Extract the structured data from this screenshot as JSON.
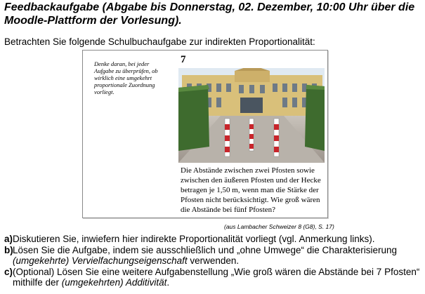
{
  "title": "Feedbackaufgabe (Abgabe bis Donnerstag, 02. Dezember, 10:00 Uhr über die Moodle-Plattform der Vorlesung).",
  "intro": "Betrachten Sie folgende Schulbuchaufgabe zur indirekten Proportionalität:",
  "figure": {
    "note": "Denke daran, bei jeder Aufgabe zu überprüfen, ob wirklich eine umgekehrt proportionale Zuordnung vorliegt.",
    "task_number": "7",
    "task_text": "Die Abstände zwischen zwei Pfosten sowie zwischen den äußeren Pfosten und der Hecke betragen je 1,50 m, wenn man die Stärke der Pfosten nicht berücksichtigt. Wie groß wären die Abstände bei fünf Pfosten?",
    "source": "(aus Lambacher Schweizer 8 (G8), S. 17)"
  },
  "items": {
    "a": {
      "label": "a)",
      "text": "Diskutieren Sie, inwiefern hier indirekte Proportionalität vorliegt (vgl. Anmerkung links)."
    },
    "b": {
      "label": "b)",
      "text1": "Lösen Sie die Aufgabe, indem sie ausschließlich und „ohne Umwege“ die Charakterisierung",
      "em": "(umgekehrte) Vervielfachungseigenschaft",
      "text2": " verwenden."
    },
    "c": {
      "label": "c)",
      "text1": "(Optional) Lösen Sie eine weitere Aufgabenstellung „Wie groß wären die Abstände bei 7 Pfosten“ mithilfe der ",
      "em": "(umgekehrten) Additivität",
      "text2": "."
    }
  }
}
